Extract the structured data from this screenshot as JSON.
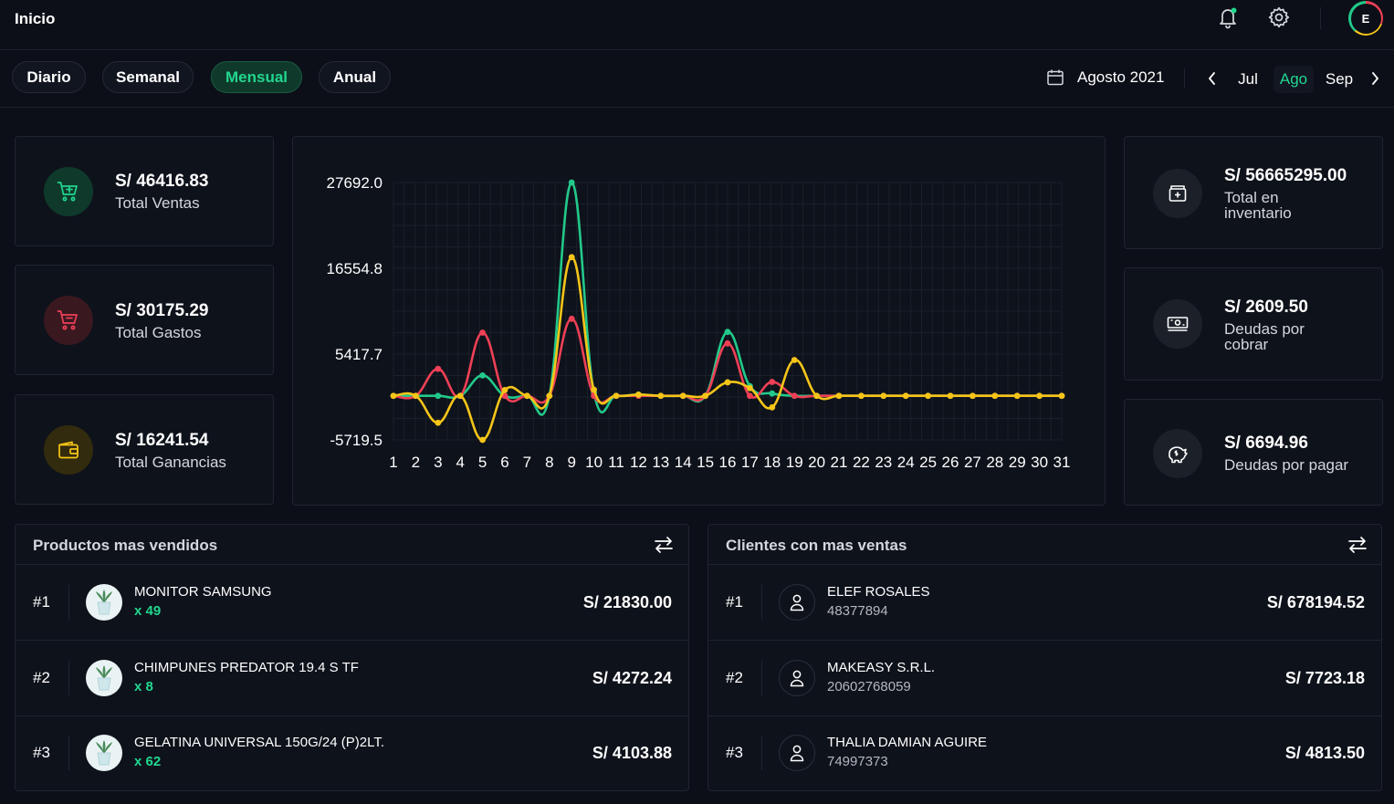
{
  "header": {
    "title": "Inicio",
    "avatar_initial": "E"
  },
  "period": {
    "tabs": [
      {
        "label": "Diario",
        "active": false
      },
      {
        "label": "Semanal",
        "active": false
      },
      {
        "label": "Mensual",
        "active": true
      },
      {
        "label": "Anual",
        "active": false
      }
    ],
    "current_label": "Agosto 2021",
    "months": [
      {
        "label": "Jul",
        "active": false
      },
      {
        "label": "Ago",
        "active": true
      },
      {
        "label": "Sep",
        "active": false
      }
    ]
  },
  "stats_left": [
    {
      "value": "S/ 46416.83",
      "label": "Total Ventas",
      "icon": "cart-plus-icon",
      "color": "#22d68f"
    },
    {
      "value": "S/ 30175.29",
      "label": "Total Gastos",
      "icon": "cart-minus-icon",
      "color": "#ef4056"
    },
    {
      "value": "S/ 16241.54",
      "label": "Total Ganancias",
      "icon": "wallet-icon",
      "color": "#f5c518"
    }
  ],
  "stats_right": [
    {
      "value": "S/ 56665295.00",
      "label": "Total en inventario",
      "icon": "inventory-box-icon"
    },
    {
      "value": "S/ 2609.50",
      "label": "Deudas por cobrar",
      "icon": "cash-icon"
    },
    {
      "value": "S/ 6694.96",
      "label": "Deudas por pagar",
      "icon": "piggy-bank-icon"
    }
  ],
  "chart_data": {
    "type": "line",
    "x": [
      1,
      2,
      3,
      4,
      5,
      6,
      7,
      8,
      9,
      10,
      11,
      12,
      13,
      14,
      15,
      16,
      17,
      18,
      19,
      20,
      21,
      22,
      23,
      24,
      25,
      26,
      27,
      28,
      29,
      30,
      31
    ],
    "y_ticks": [
      "27692.0",
      "16554.8",
      "5417.7",
      "-5719.5"
    ],
    "y_tick_values": [
      27692.0,
      16554.8,
      5417.7,
      -5719.5
    ],
    "ylim": [
      -5719.5,
      27692.0
    ],
    "grid": true,
    "series": [
      {
        "color": "#22c98a",
        "values": [
          0,
          0,
          0,
          0,
          2650,
          0,
          0,
          0,
          27692,
          420,
          0,
          150,
          0,
          0,
          0,
          8300,
          1250,
          300,
          0,
          0,
          0,
          0,
          0,
          0,
          0,
          0,
          0,
          0,
          0,
          0,
          0
        ]
      },
      {
        "color": "#ef4056",
        "values": [
          0,
          0,
          3500,
          0,
          8200,
          0,
          0,
          0,
          10000,
          0,
          0,
          0,
          0,
          0,
          0,
          6800,
          0,
          1800,
          0,
          0,
          0,
          0,
          0,
          0,
          0,
          0,
          0,
          0,
          0,
          0,
          0
        ]
      },
      {
        "color": "#f5c518",
        "values": [
          0,
          0,
          -3500,
          0,
          -5719.5,
          750,
          0,
          0,
          18000,
          800,
          0,
          150,
          0,
          0,
          0,
          1750,
          1000,
          -1500,
          4650,
          0,
          0,
          0,
          0,
          0,
          0,
          0,
          0,
          0,
          0,
          0,
          0
        ]
      }
    ]
  },
  "top_products": {
    "title": "Productos mas vendidos",
    "items": [
      {
        "rank": "#1",
        "name": "MONITOR SAMSUNG",
        "qty": "x 49",
        "amount": "S/ 21830.00"
      },
      {
        "rank": "#2",
        "name": "CHIMPUNES PREDATOR 19.4 S TF",
        "qty": "x 8",
        "amount": "S/ 4272.24"
      },
      {
        "rank": "#3",
        "name": "GELATINA UNIVERSAL 150G/24 (P)2LT.",
        "qty": "x 62",
        "amount": "S/ 4103.88"
      }
    ]
  },
  "top_clients": {
    "title": "Clientes con mas ventas",
    "items": [
      {
        "rank": "#1",
        "name": "ELEF ROSALES",
        "doc": "48377894",
        "amount": "S/ 678194.52"
      },
      {
        "rank": "#2",
        "name": "MAKEASY S.R.L.",
        "doc": "20602768059",
        "amount": "S/ 7723.18"
      },
      {
        "rank": "#3",
        "name": "THALIA DAMIAN AGUIRE",
        "doc": "74997373",
        "amount": "S/ 4813.50"
      }
    ]
  }
}
